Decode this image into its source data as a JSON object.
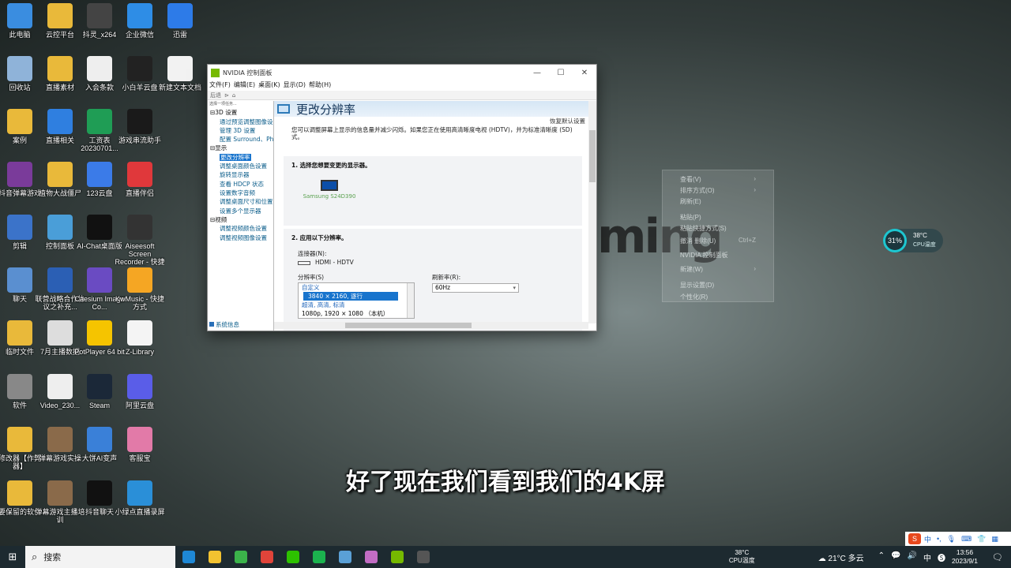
{
  "desktop": {
    "icons": [
      {
        "label": "此电脑",
        "icon": "computer-icon",
        "color": "#3a8de0"
      },
      {
        "label": "云控平台",
        "icon": "folder-icon",
        "color": "#e9b93a"
      },
      {
        "label": "抖灵_x264",
        "icon": "video-file-icon",
        "color": "#444444"
      },
      {
        "label": "企业微信",
        "icon": "wecom-icon",
        "color": "#2e8de6"
      },
      {
        "label": "迅雷",
        "icon": "thunder-icon",
        "color": "#2d7be8"
      },
      {
        "label": "回收站",
        "icon": "recycle-bin-icon",
        "color": "#8fb3d9"
      },
      {
        "label": "直播素材",
        "icon": "folder-icon",
        "color": "#e9b93a"
      },
      {
        "label": "入会条款",
        "icon": "document-icon",
        "color": "#eeeeee"
      },
      {
        "label": "小白羊云盘",
        "icon": "sheep-cloud-icon",
        "color": "#222222"
      },
      {
        "label": "新建文本文档",
        "icon": "text-file-icon",
        "color": "#f2f2f2"
      },
      {
        "label": "案例",
        "icon": "folder-icon",
        "color": "#e9b93a"
      },
      {
        "label": "直播相关",
        "icon": "play-icon",
        "color": "#2f7fe0"
      },
      {
        "label": "工资表20230701...",
        "icon": "spreadsheet-icon",
        "color": "#1f9d55"
      },
      {
        "label": "游戏串流助手",
        "icon": "stream-assistant-icon",
        "color": "#1a1a1a"
      },
      {
        "label": "抖音弹幕游戏",
        "icon": "winrar-icon",
        "color": "#7a3b9a"
      },
      {
        "label": "植物大战僵尸",
        "icon": "folder-icon",
        "color": "#e9b93a"
      },
      {
        "label": "123云盘",
        "icon": "cloud-123-icon",
        "color": "#3b7be8"
      },
      {
        "label": "直播伴侣",
        "icon": "live-companion-icon",
        "color": "#e0383b"
      },
      {
        "label": "剪辑",
        "icon": "scissors-icon",
        "color": "#3b73c9"
      },
      {
        "label": "控制面板",
        "icon": "control-panel-icon",
        "color": "#4a9ed8"
      },
      {
        "label": "AI-Chat桌面版",
        "icon": "ai-chat-icon",
        "color": "#111111"
      },
      {
        "label": "Aiseesoft Screen Recorder - 快捷方式",
        "icon": "recorder-icon",
        "color": "#333333"
      },
      {
        "label": "聊天",
        "icon": "chat-users-icon",
        "color": "#5a8fd0"
      },
      {
        "label": "联营战略合作协议之补充...",
        "icon": "word-doc-icon",
        "color": "#2b5fb4"
      },
      {
        "label": "Caesium Image Co...",
        "icon": "caesium-icon",
        "color": "#6a4bc2"
      },
      {
        "label": "KwMusic - 快捷方式",
        "icon": "kwmusic-icon",
        "color": "#f5a623"
      },
      {
        "label": "临时文件",
        "icon": "folder-icon",
        "color": "#e9b93a"
      },
      {
        "label": "7月主播数据",
        "icon": "data-file-icon",
        "color": "#dddddd"
      },
      {
        "label": "PotPlayer 64 bit",
        "icon": "potplayer-icon",
        "color": "#f5c400"
      },
      {
        "label": "Z-Library",
        "icon": "zlibrary-icon",
        "color": "#f4f4f4"
      },
      {
        "label": "软件",
        "icon": "software-icon",
        "color": "#888888"
      },
      {
        "label": "Video_230...",
        "icon": "video-file-icon",
        "color": "#eeeeee"
      },
      {
        "label": "Steam",
        "icon": "steam-icon",
        "color": "#1b2838"
      },
      {
        "label": "阿里云盘",
        "icon": "aliyun-drive-icon",
        "color": "#5a5de8"
      },
      {
        "label": "修改器【作弊器】",
        "icon": "folder-icon",
        "color": "#e9b93a"
      },
      {
        "label": "弹幕游戏实操",
        "icon": "video-thumb-icon",
        "color": "#8a6a4a"
      },
      {
        "label": "大饼AI变声",
        "icon": "voice-changer-icon",
        "color": "#3a80d8"
      },
      {
        "label": "客服宝",
        "icon": "kefubao-icon",
        "color": "#e27aa8"
      },
      {
        "label": "要保留的软件",
        "icon": "folder-icon",
        "color": "#e9b93a"
      },
      {
        "label": "弹幕游戏主播培训",
        "icon": "video-thumb-icon",
        "color": "#8a6a4a"
      },
      {
        "label": "抖音聊天",
        "icon": "douyin-chat-icon",
        "color": "#111111"
      },
      {
        "label": "小绿点直播录屏",
        "icon": "screen-record-icon",
        "color": "#2a8fd8"
      }
    ]
  },
  "window": {
    "title": "NVIDIA 控制面板",
    "min": "—",
    "max": "☐",
    "close": "✕",
    "menu": [
      "文件(F)",
      "编辑(E)",
      "桌面(K)",
      "显示(D)",
      "帮助(H)"
    ],
    "toolbar": {
      "back": "后退",
      "forward": "⊳",
      "home": "⌂"
    },
    "task_label": "选择一项任务...",
    "tree": [
      {
        "type": "cat",
        "label": "⊟3D 设置"
      },
      {
        "type": "item",
        "label": "通过预览调整图像设置"
      },
      {
        "type": "item",
        "label": "管理 3D 设置"
      },
      {
        "type": "item",
        "label": "配置 Surround、PhysX"
      },
      {
        "type": "cat",
        "label": "⊟显示"
      },
      {
        "type": "item",
        "label": "更改分辨率",
        "selected": true
      },
      {
        "type": "item",
        "label": "调整桌面颜色设置"
      },
      {
        "type": "item",
        "label": "旋转显示器"
      },
      {
        "type": "item",
        "label": "查看 HDCP 状态"
      },
      {
        "type": "item",
        "label": "设置数字音频"
      },
      {
        "type": "item",
        "label": "调整桌面尺寸和位置"
      },
      {
        "type": "item",
        "label": "设置多个显示器"
      },
      {
        "type": "cat",
        "label": "⊟视频"
      },
      {
        "type": "item",
        "label": "调整视频颜色设置"
      },
      {
        "type": "item",
        "label": "调整视频图像设置"
      }
    ],
    "system_info": "系统信息",
    "page_title": "更改分辨率",
    "restore_defaults": "恢复默认设置",
    "description": "您可以调整屏幕上显示的信息量并减少闪烁。如果您正在使用高清晰度电视 (HDTV)，并为标准清晰度 (SD) 式。",
    "step1": "1. 选择您想要变更的显示器。",
    "monitor_name": "Samsung S24D390",
    "step2": "2. 应用以下分辨率。",
    "connector_label": "连接器(N):",
    "connector_value": "HDMI - HDTV",
    "resolution_label": "分辨率(S)",
    "refresh_label": "刷新率(R):",
    "refresh_value": "60Hz",
    "resolution_list": [
      {
        "label": "自定义",
        "kind": "group"
      },
      {
        "label": "3840 × 2160, 逐行",
        "kind": "selected"
      },
      {
        "label": "超清, 高清, 标清",
        "kind": "group"
      },
      {
        "label": "1080p, 1920 × 1080 （本机）",
        "kind": "normal"
      }
    ]
  },
  "context_menu": {
    "items": [
      {
        "label": "查看(V)",
        "key": "›"
      },
      {
        "label": "排序方式(O)",
        "key": "›"
      },
      {
        "label": "刷新(E)",
        "key": ""
      },
      {
        "label": "粘贴(P)",
        "key": ""
      },
      {
        "label": "粘贴快捷方式(S)",
        "key": ""
      },
      {
        "label": "撤消 删除(U)",
        "key": "Ctrl+Z"
      },
      {
        "label": "NVIDIA 控制面板",
        "key": ""
      },
      {
        "label": "新建(W)",
        "key": "›"
      },
      {
        "label": "显示设置(D)",
        "key": ""
      },
      {
        "label": "个性化(R)",
        "key": ""
      }
    ]
  },
  "ghost_text": "ming",
  "widget": {
    "percent": "31%",
    "temp": "38°C",
    "label": "CPU温度"
  },
  "subtitle": "好了现在我们看到我们的4K屏",
  "ime": {
    "logo": "S",
    "items": [
      "中",
      "•,",
      "🎙",
      "⌨",
      "👕",
      "▦"
    ]
  },
  "taskbar": {
    "start": "⊞",
    "search_icon": "⌕",
    "search_placeholder": "搜索",
    "apps": [
      {
        "name": "edge-icon",
        "color": "#1e88d6"
      },
      {
        "name": "file-explorer-icon",
        "color": "#f2c230"
      },
      {
        "name": "wechat-green-icon",
        "color": "#3bb34a"
      },
      {
        "name": "chrome-icon",
        "color": "#e0443a"
      },
      {
        "name": "wechat-icon",
        "color": "#2dc100"
      },
      {
        "name": "stream-icon",
        "color": "#1bb34e"
      },
      {
        "name": "feather-icon",
        "color": "#5aa0d6"
      },
      {
        "name": "character-icon",
        "color": "#c26dc4"
      },
      {
        "name": "nvidia-icon",
        "color": "#76b900"
      },
      {
        "name": "recorder-taskbar-icon",
        "color": "#555555"
      }
    ],
    "cpu_temp": "38°C",
    "cpu_label": "CPU温度",
    "weather": "21°C 多云",
    "tray_icons": [
      "⌃",
      "💬",
      "🔊",
      "中",
      "🅢"
    ],
    "time": "13:56",
    "date": "2023/9/1",
    "notification": "🗨"
  }
}
